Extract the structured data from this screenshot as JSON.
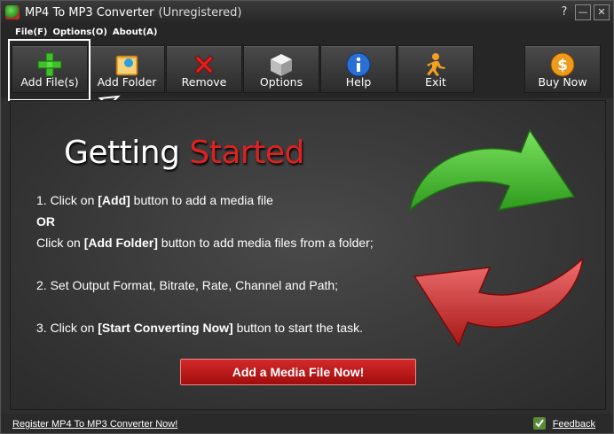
{
  "window": {
    "title": "MP4 To MP3 Converter",
    "status": "(Unregistered)",
    "controls": {
      "help": "?",
      "minimize": "—",
      "close": "✕"
    }
  },
  "menu": [
    {
      "label": "File(F)"
    },
    {
      "label": "Options(O)"
    },
    {
      "label": "About(A)"
    }
  ],
  "toolbar": {
    "add_files": "Add File(s)",
    "add_folder": "Add Folder",
    "remove": "Remove",
    "options": "Options",
    "help": "Help",
    "exit": "Exit",
    "buy_now": "Buy Now"
  },
  "content": {
    "heading_part1": "Getting",
    "heading_part2": "Started",
    "step1_pre": "1. Click on ",
    "step1_bold": "[Add]",
    "step1_post": " button to add a media file",
    "or": "OR",
    "step1b_pre": "Click on ",
    "step1b_bold": "[Add Folder]",
    "step1b_post": " button to add media files from a folder;",
    "step2": "2. Set Output Format, Bitrate, Rate, Channel and Path;",
    "step3_pre": "3. Click on ",
    "step3_bold": "[Start Converting Now]",
    "step3_post": " button to start the task.",
    "cta": "Add a Media File Now!"
  },
  "status": {
    "register": "Register MP4 To MP3 Converter Now!",
    "feedback": "Feedback"
  },
  "colors": {
    "accent_red": "#d22222",
    "cta_red": "#b81414",
    "arrow_green": "#4fc63a",
    "arrow_red": "#d43a3a"
  }
}
